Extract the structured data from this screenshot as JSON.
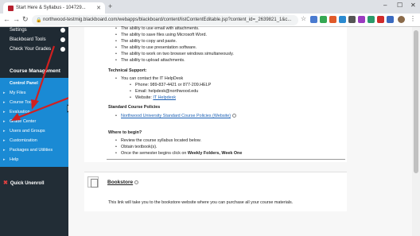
{
  "browser": {
    "tab_title": "Start Here & Syllabus - 104729...",
    "url": "northwood-testmig.blackboard.com/webapps/blackboard/content/listContentEditable.jsp?content_id=_2639821_1&c..."
  },
  "sidebar": {
    "top_items": [
      {
        "label": "Settings"
      },
      {
        "label": "Blackboard Tools"
      },
      {
        "label": "Check Your Grades"
      }
    ],
    "section_title": "Course Management",
    "items": [
      {
        "label": "Control Panel"
      },
      {
        "label": "My Files"
      },
      {
        "label": "Course Tools"
      },
      {
        "label": "Evaluation"
      },
      {
        "label": "Grade Center"
      },
      {
        "label": "Users and Groups"
      },
      {
        "label": "Customization"
      },
      {
        "label": "Packages and Utilities"
      },
      {
        "label": "Help"
      }
    ],
    "quick_unenroll": "Quick Unenroll"
  },
  "content": {
    "abilities": [
      "The ability to use email with attachments.",
      "The ability to save files using Microsoft Word.",
      "The ability to copy and paste.",
      "The ability to use presentation software.",
      "The ability to work on two browser windows simultaneously.",
      "The ability to upload attachments."
    ],
    "tech_support_title": "Technical Support:",
    "tech_intro": "You can contact the IT HelpDesk",
    "tech_phone": "Phone: 989-837-4421 or 877-209.HELP",
    "tech_email": "Email: helpdesk@northwood.edu",
    "tech_website_label": "Website: ",
    "tech_website_link": "IT Helpdesk",
    "policies_title": "Standard Course Policies",
    "policies_link": "Northwood University Standard Course Policies (Website)",
    "where_title": "Where to begin?",
    "where_items": [
      "Review the course syllabus located below.",
      "Obtain textbook(s).",
      "Once the semester begins click on "
    ],
    "where_bold": "Weekly Folders, Week One",
    "bookstore_title": "Bookstore",
    "bookstore_desc": "This link will take you to the bookstore website where you can purchase all your course materials."
  }
}
